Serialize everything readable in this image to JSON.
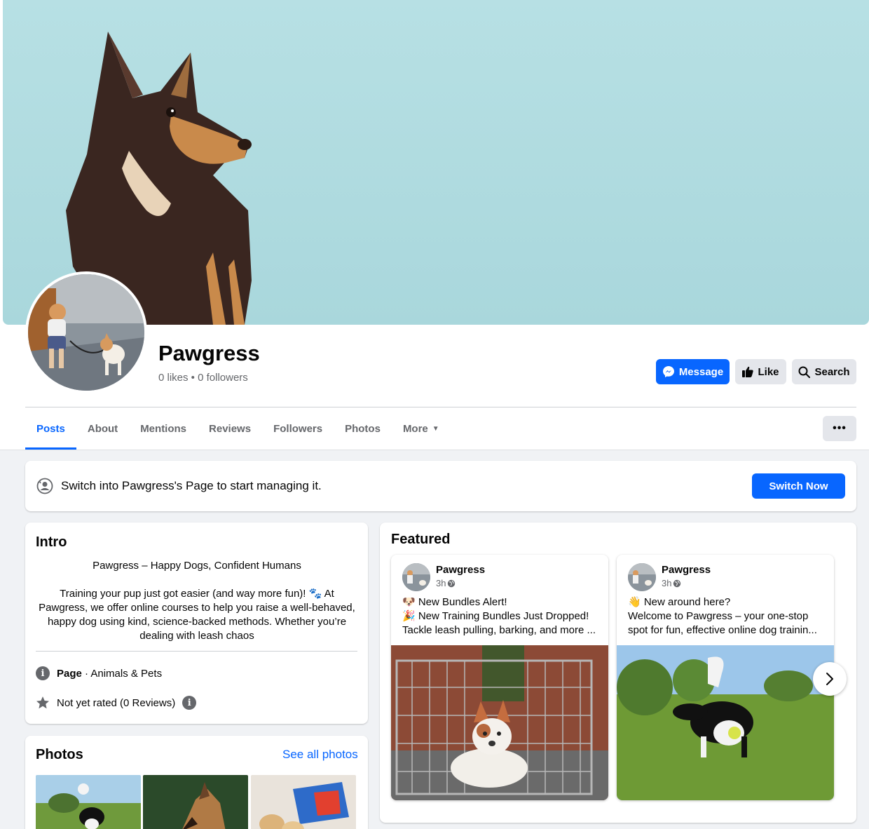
{
  "page": {
    "name": "Pawgress",
    "stats": "0 likes • 0 followers"
  },
  "actions": {
    "message": "Message",
    "like": "Like",
    "search": "Search"
  },
  "tabs": [
    {
      "label": "Posts",
      "active": true
    },
    {
      "label": "About"
    },
    {
      "label": "Mentions"
    },
    {
      "label": "Reviews"
    },
    {
      "label": "Followers"
    },
    {
      "label": "Photos"
    },
    {
      "label": "More"
    }
  ],
  "more_menu": "•••",
  "switch_bar": {
    "text": "Switch into Pawgress's Page to start managing it.",
    "button": "Switch Now"
  },
  "intro": {
    "title": "Intro",
    "bio_line1": "Pawgress – Happy Dogs, Confident Humans",
    "bio_line2": "Training your pup just got easier (and way more fun)! 🐾 At Pawgress, we offer online courses to help you raise a well-behaved, happy dog using kind, science-backed methods. Whether you’re dealing with leash chaos",
    "category_label": "Page",
    "category_value": " · Animals & Pets",
    "rating": "Not yet rated (0 Reviews)"
  },
  "photos": {
    "title": "Photos",
    "see_all": "See all photos"
  },
  "featured": {
    "title": "Featured",
    "posts": [
      {
        "author": "Pawgress",
        "time": "3h",
        "lines": [
          "🐶 New Bundles Alert!",
          "🎉 New Training Bundles Just Dropped!",
          "Tackle leash pulling, barking, and more ..."
        ]
      },
      {
        "author": "Pawgress",
        "time": "3h",
        "lines": [
          "👋 New around here?",
          "Welcome to Pawgress – your one-stop",
          "spot for fun, effective online dog trainin..."
        ]
      }
    ]
  },
  "icons": {
    "message": "messenger-icon",
    "like": "thumbs-up-icon",
    "search": "search-icon",
    "switch": "profile-switch-icon",
    "info": "info-icon",
    "star": "star-icon",
    "globe": "globe-icon",
    "next": "chevron-right-icon"
  },
  "colors": {
    "primary": "#0866ff",
    "secondary_bg": "#e4e6eb",
    "muted_text": "#65676b",
    "page_bg": "#f0f2f5"
  }
}
